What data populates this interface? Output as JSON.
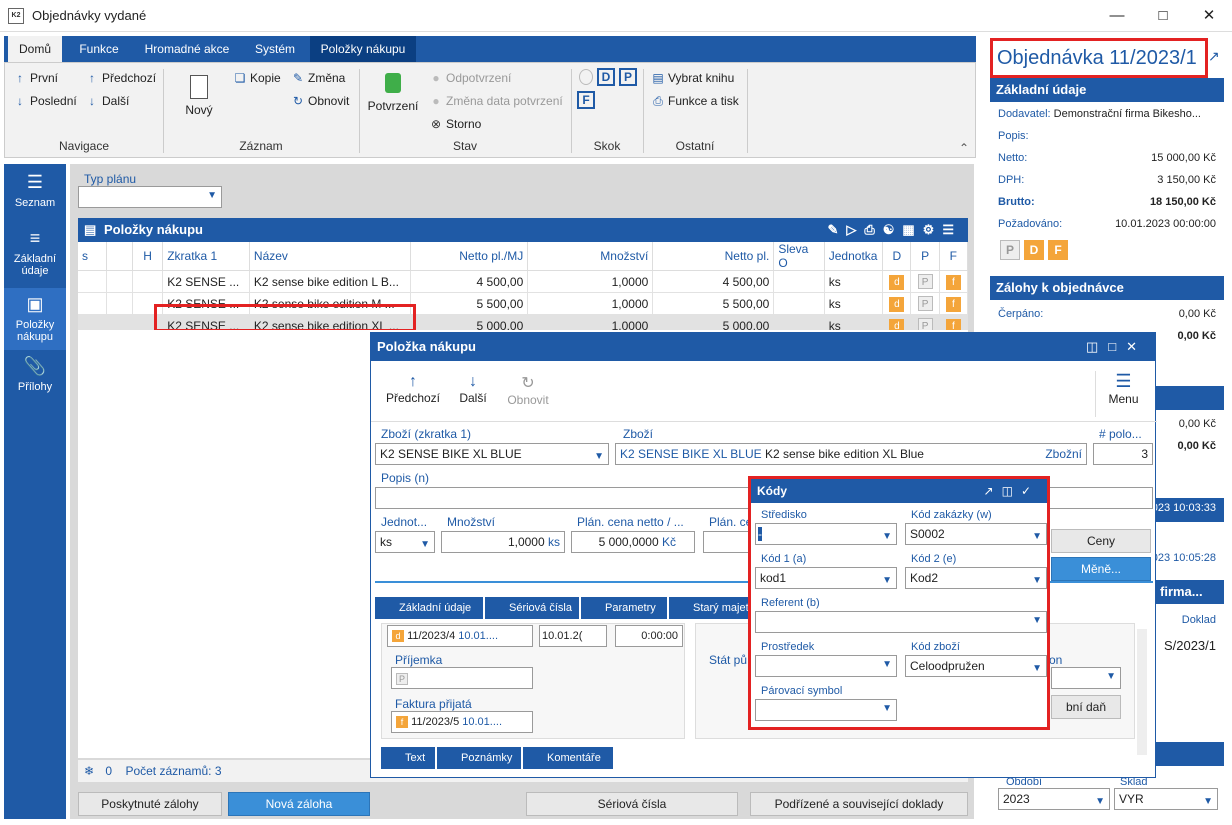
{
  "window": {
    "title": "Objednávky vydané",
    "logo": "K2"
  },
  "ribbon": {
    "tabs": [
      "Domů",
      "Funkce",
      "Hromadné akce",
      "Systém",
      "Položky nákupu"
    ],
    "nav": {
      "first": "První",
      "prev": "Předchozí",
      "last": "Poslední",
      "next": "Další",
      "group": "Navigace"
    },
    "record": {
      "new": "Nový",
      "copy": "Kopie",
      "change": "Změna",
      "refresh": "Obnovit",
      "group": "Záznam"
    },
    "state": {
      "confirm": "Potvrzení",
      "unconfirm": "Odpotvrzení",
      "change_date": "Změna data potvrzení",
      "cancel": "Storno",
      "group": "Stav"
    },
    "jump": {
      "d": "D",
      "p": "P",
      "f": "F",
      "group": "Skok"
    },
    "other": {
      "book": "Vybrat knihu",
      "print": "Funkce a tisk",
      "group": "Ostatní"
    }
  },
  "leftnav": [
    {
      "label": "Seznam"
    },
    {
      "label": "Základní údaje"
    },
    {
      "label": "Položky nákupu"
    },
    {
      "label": "Přílohy"
    }
  ],
  "main": {
    "plan_type_label": "Typ plánu",
    "grid_title": "Položky nákupu",
    "columns": [
      "s",
      "",
      "H",
      "Zkratka 1",
      "Název",
      "Netto pl./MJ",
      "Množství",
      "Netto pl.",
      "Sleva O",
      "Jednotka",
      "D",
      "P",
      "F"
    ],
    "rows": [
      {
        "code": "K2 SENSE ...",
        "name": "K2 sense bike edition L B...",
        "unit_price": "4 500,00",
        "qty": "1,0000",
        "net": "4 500,00",
        "unit": "ks"
      },
      {
        "code": "K2 SENSE ...",
        "name": "K2 sense bike edition M ...",
        "unit_price": "5 500,00",
        "qty": "1,0000",
        "net": "5 500,00",
        "unit": "ks"
      },
      {
        "code": "K2 SENSE ...",
        "name": "K2 sense bike edition XL ...",
        "unit_price": "5 000,00",
        "qty": "1,0000",
        "net": "5 000,00",
        "unit": "ks"
      }
    ],
    "badges": {
      "d": "d",
      "p": "P",
      "f": "f"
    },
    "footer": {
      "count_zero": "0",
      "count_label": "Počet záznamů: 3"
    },
    "bottom_buttons": {
      "deposits": "Poskytnuté zálohy",
      "new_deposit": "Nová záloha",
      "serial": "Sériová čísla",
      "related": "Podřízené a související doklady"
    }
  },
  "right": {
    "title": "Objednávka 11/2023/1",
    "basic": {
      "header": "Základní údaje",
      "supplier_l": "Dodavatel:",
      "supplier_v": "Demonstrační firma Bikesho...",
      "desc_l": "Popis:",
      "net_l": "Netto:",
      "net_v": "15 000,00 Kč",
      "vat_l": "DPH:",
      "vat_v": "3 150,00 Kč",
      "gross_l": "Brutto:",
      "gross_v": "18 150,00 Kč",
      "req_l": "Požadováno:",
      "req_v": "10.01.2023 00:00:00",
      "p": "P",
      "d": "D",
      "f": "F"
    },
    "deposits": {
      "header": "Zálohy k objednávce",
      "drawn_l": "Čerpáno:",
      "drawn_v": "0,00 Kč",
      "v2": "0,00 Kč"
    },
    "sec3": {
      "v1": "0,00 Kč",
      "v2": "0,00 Kč"
    },
    "sec4": {
      "t1": "2023 10:03:33",
      "t2": "2023 10:05:28"
    },
    "sec5": {
      "header_tail": "firma...",
      "col": "Doklad",
      "val": "S/2023/1"
    },
    "sec6": {
      "period_l": "Období",
      "period_v": "2023",
      "store_l": "Sklad",
      "store_v": "VYR"
    }
  },
  "dialog": {
    "title": "Položka nákupu",
    "prev": "Předchozí",
    "next": "Další",
    "refresh": "Obnovit",
    "menu": "Menu",
    "goods_code_l": "Zboží (zkratka 1)",
    "goods_code_v": "K2 SENSE BIKE XL BLUE",
    "goods_l": "Zboží",
    "goods_v_code": "K2 SENSE BIKE XL BLUE",
    "goods_v_name": "K2 sense bike edition XL Blue",
    "goods_type": "Zbožní",
    "pos_l": "# polo...",
    "pos_v": "3",
    "desc_l": "Popis (n)",
    "unit_l": "Jednot...",
    "unit_v": "ks",
    "qty_l": "Množství",
    "qty_v": "1,0000",
    "qty_u": "ks",
    "plan_price_l": "Plán. cena netto / ...",
    "plan_price_v": "5 000,0000",
    "plan_price_u": "Kč",
    "plan_l2": "Plán. ce",
    "prices_btn": "Ceny",
    "currency_btn": "Měně...",
    "tabs": [
      "Základní údaje",
      "Sériová čísla",
      "Parametry",
      "Starý majet"
    ],
    "doc1_v": "11/2023/4",
    "doc1_d": "10.01....",
    "date_v": "10.01.2(",
    "time_v": "0:00:00",
    "receipt_l": "Příjemka",
    "receipt_p": "P",
    "invoice_l": "Faktura přijatá",
    "invoice_v": "11/2023/5",
    "invoice_d": "10.01....",
    "state_l": "Stát pů",
    "on_l": "on",
    "tax_btn": "bní daň",
    "bottom_tabs": [
      "Text",
      "Poznámky",
      "Komentáře"
    ]
  },
  "kody": {
    "title": "Kódy",
    "center_l": "Středisko",
    "center_v": "-",
    "order_code_l": "Kód zakázky (w)",
    "order_code_v": "S0002",
    "code1_l": "Kód 1 (a)",
    "code1_v": "kod1",
    "code2_l": "Kód 2 (e)",
    "code2_v": "Kod2",
    "referent_l": "Referent (b)",
    "means_l": "Prostředek",
    "goods_code_l": "Kód zboží",
    "goods_code_v": "Celoodpružen",
    "pair_l": "Párovací symbol"
  },
  "colors": {
    "accent": "#1f5aa6",
    "highlight": "#e32222",
    "badge": "#f4a53a"
  }
}
